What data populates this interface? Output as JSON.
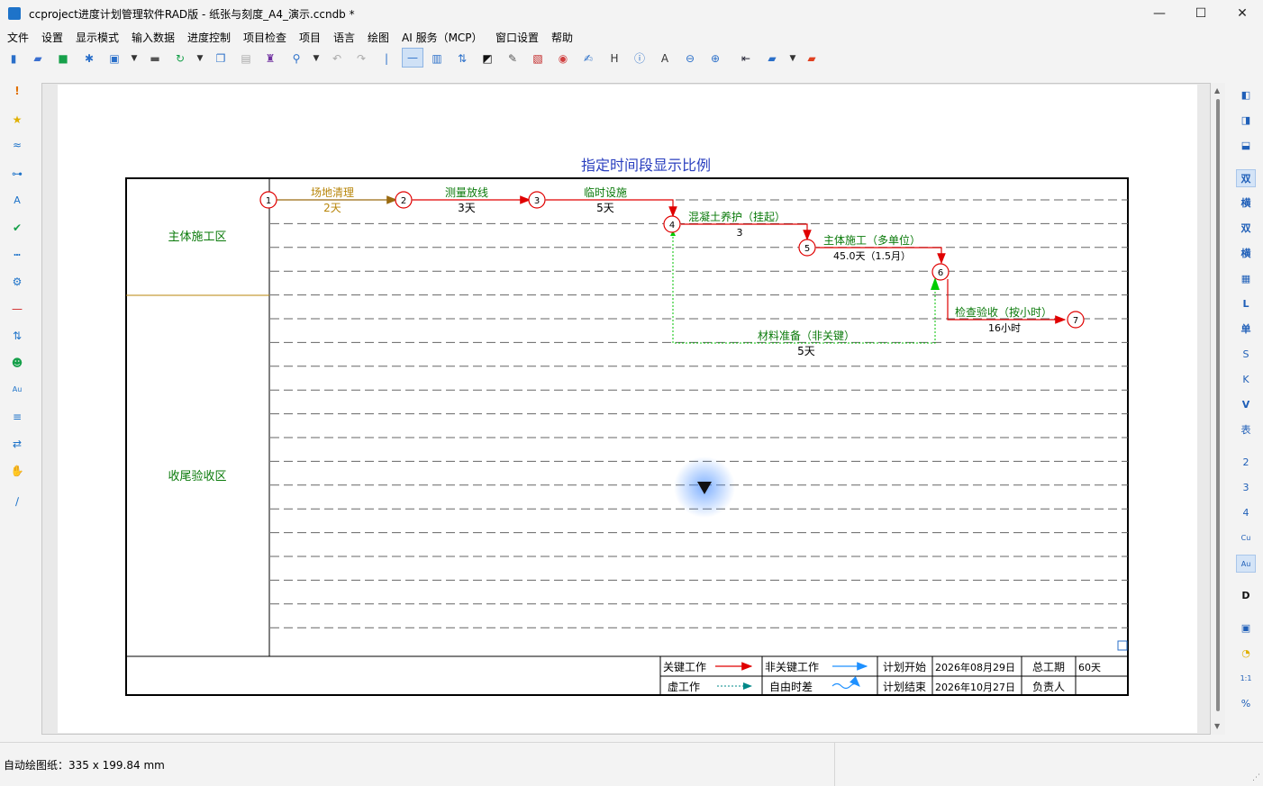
{
  "window": {
    "title": "ccproject进度计划管理软件RAD版 - 纸张与刻度_A4_演示.ccndb *",
    "min": "—",
    "max": "☐",
    "close": "✕"
  },
  "menu": [
    "文件",
    "设置",
    "显示模式",
    "输入数据",
    "进度控制",
    "项目检查",
    "项目",
    "语言",
    "绘图",
    "AI 服务（MCP）",
    "窗口设置",
    "帮助"
  ],
  "chart": {
    "title": "指定时间段显示比例",
    "zones": [
      "主体施工区",
      "收尾验收区"
    ],
    "nodes": [
      "1",
      "2",
      "3",
      "4",
      "5",
      "6",
      "7"
    ],
    "activities": [
      {
        "name": "场地清理",
        "duration": "2天"
      },
      {
        "name": "测量放线",
        "duration": "3天"
      },
      {
        "name": "临时设施",
        "duration": "5天"
      },
      {
        "name": "混凝土养护（挂起）",
        "duration": "3"
      },
      {
        "name": "主体施工（多单位）",
        "duration": "45.0天（1.5月）"
      },
      {
        "name": "检查验收（按小时）",
        "duration": "16小时"
      },
      {
        "name": "材料准备（非关键）",
        "duration": "5天"
      }
    ],
    "legend": {
      "critical": "关键工作",
      "noncritical": "非关键工作",
      "dummy": "虚工作",
      "float": "自由时差",
      "plan_start_label": "计划开始",
      "plan_start": "2026年08月29日",
      "plan_end_label": "计划结束",
      "plan_end": "2026年10月27日",
      "duration_label": "总工期",
      "duration": "60天",
      "owner_label": "负责人",
      "owner": ""
    },
    "colors": {
      "critical": "#e00000",
      "noncritical": "#1e90ff",
      "dummy": "#00c000",
      "zone_text": "#0a7a0a",
      "title": "#2a3fbf",
      "first_activity": "#b8860b"
    }
  },
  "status": {
    "paper": "自动绘图纸：335 x 199.84 mm"
  }
}
